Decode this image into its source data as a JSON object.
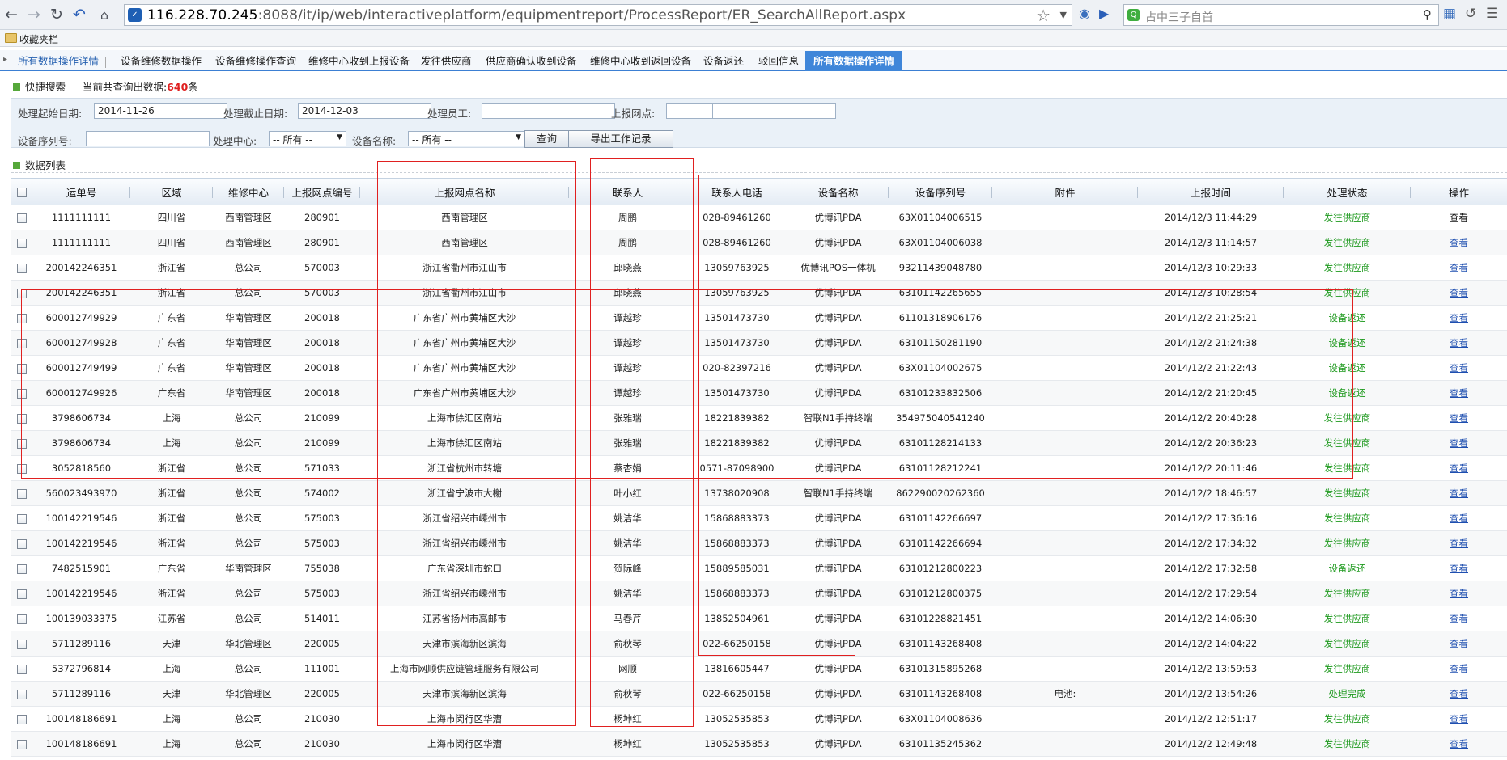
{
  "browser": {
    "url_host": "116.228.70.245",
    "url_path": ":8088/it/ip/web/interactiveplatform/equipmentreport/ProcessReport/ER_SearchAllReport.aspx",
    "search_placeholder": "占中三子自首",
    "bookmarks_label": "收藏夹栏"
  },
  "tabs": {
    "first": "所有数据操作详情",
    "items": [
      "设备维修数据操作",
      "设备维修操作查询",
      "维修中心收到上报设备",
      "发往供应商",
      "供应商确认收到设备",
      "维修中心收到返回设备",
      "设备返还",
      "驳回信息"
    ],
    "active": "所有数据操作详情"
  },
  "search": {
    "heading": "快捷搜索",
    "count_label": "当前共查询出数据:",
    "count_value": "640",
    "count_unit": "条",
    "start_date_label": "处理起始日期:",
    "start_date_value": "2014-11-26",
    "end_date_label": "处理截止日期:",
    "end_date_value": "2014-12-03",
    "staff_label": "处理员工:",
    "staff_value": "",
    "site_label": "上报网点:",
    "serial_label": "设备序列号:",
    "serial_value": "",
    "center_label": "处理中心:",
    "center_value": "-- 所有 --",
    "device_label": "设备名称:",
    "device_value": "-- 所有 --",
    "query_button": "查询",
    "export_button": "导出工作记录"
  },
  "list": {
    "heading": "数据列表",
    "columns": [
      "运单号",
      "区域",
      "维修中心",
      "上报网点编号",
      "上报网点名称",
      "联系人",
      "联系人电话",
      "设备名称",
      "设备序列号",
      "附件",
      "上报时间",
      "处理状态",
      "操作"
    ],
    "rows": [
      [
        "1111111111",
        "四川省",
        "西南管理区",
        "280901",
        "西南管理区",
        "周鹏",
        "028-89461260",
        "优博讯PDA",
        "63X01104006515",
        "",
        "2014/12/3 11:44:29",
        "发往供应商",
        "查看"
      ],
      [
        "1111111111",
        "四川省",
        "西南管理区",
        "280901",
        "西南管理区",
        "周鹏",
        "028-89461260",
        "优博讯PDA",
        "63X01104006038",
        "",
        "2014/12/3 11:14:57",
        "发往供应商",
        "查看"
      ],
      [
        "200142246351",
        "浙江省",
        "总公司",
        "570003",
        "浙江省衢州市江山市",
        "邱晓燕",
        "13059763925",
        "优博讯POS一体机",
        "93211439048780",
        "",
        "2014/12/3 10:29:33",
        "发往供应商",
        "查看"
      ],
      [
        "200142246351",
        "浙江省",
        "总公司",
        "570003",
        "浙江省衢州市江山市",
        "邱晓燕",
        "13059763925",
        "优博讯PDA",
        "63101142265655",
        "",
        "2014/12/3 10:28:54",
        "发往供应商",
        "查看"
      ],
      [
        "600012749929",
        "广东省",
        "华南管理区",
        "200018",
        "广东省广州市黄埔区大沙",
        "谭越珍",
        "13501473730",
        "优博讯PDA",
        "61101318906176",
        "",
        "2014/12/2 21:25:21",
        "设备返还",
        "查看"
      ],
      [
        "600012749928",
        "广东省",
        "华南管理区",
        "200018",
        "广东省广州市黄埔区大沙",
        "谭越珍",
        "13501473730",
        "优博讯PDA",
        "63101150281190",
        "",
        "2014/12/2 21:24:38",
        "设备返还",
        "查看"
      ],
      [
        "600012749499",
        "广东省",
        "华南管理区",
        "200018",
        "广东省广州市黄埔区大沙",
        "谭越珍",
        "020-82397216",
        "优博讯PDA",
        "63X01104002675",
        "",
        "2014/12/2 21:22:43",
        "设备返还",
        "查看"
      ],
      [
        "600012749926",
        "广东省",
        "华南管理区",
        "200018",
        "广东省广州市黄埔区大沙",
        "谭越珍",
        "13501473730",
        "优博讯PDA",
        "63101233832506",
        "",
        "2014/12/2 21:20:45",
        "设备返还",
        "查看"
      ],
      [
        "3798606734",
        "上海",
        "总公司",
        "210099",
        "上海市徐汇区南站",
        "张雅瑞",
        "18221839382",
        "智联N1手持终端",
        "354975040541240",
        "",
        "2014/12/2 20:40:28",
        "发往供应商",
        "查看"
      ],
      [
        "3798606734",
        "上海",
        "总公司",
        "210099",
        "上海市徐汇区南站",
        "张雅瑞",
        "18221839382",
        "优博讯PDA",
        "63101128214133",
        "",
        "2014/12/2 20:36:23",
        "发往供应商",
        "查看"
      ],
      [
        "3052818560",
        "浙江省",
        "总公司",
        "571033",
        "浙江省杭州市转塘",
        "蔡杏娟",
        "0571-87098900",
        "优博讯PDA",
        "63101128212241",
        "",
        "2014/12/2 20:11:46",
        "发往供应商",
        "查看"
      ],
      [
        "560023493970",
        "浙江省",
        "总公司",
        "574002",
        "浙江省宁波市大榭",
        "叶小红",
        "13738020908",
        "智联N1手持终端",
        "862290020262360",
        "",
        "2014/12/2 18:46:57",
        "发往供应商",
        "查看"
      ],
      [
        "100142219546",
        "浙江省",
        "总公司",
        "575003",
        "浙江省绍兴市嵊州市",
        "姚洁华",
        "15868883373",
        "优博讯PDA",
        "63101142266697",
        "",
        "2014/12/2 17:36:16",
        "发往供应商",
        "查看"
      ],
      [
        "100142219546",
        "浙江省",
        "总公司",
        "575003",
        "浙江省绍兴市嵊州市",
        "姚洁华",
        "15868883373",
        "优博讯PDA",
        "63101142266694",
        "",
        "2014/12/2 17:34:32",
        "发往供应商",
        "查看"
      ],
      [
        "7482515901",
        "广东省",
        "华南管理区",
        "755038",
        "广东省深圳市蛇口",
        "贺际峰",
        "15889585031",
        "优博讯PDA",
        "63101212800223",
        "",
        "2014/12/2 17:32:58",
        "设备返还",
        "查看"
      ],
      [
        "100142219546",
        "浙江省",
        "总公司",
        "575003",
        "浙江省绍兴市嵊州市",
        "姚洁华",
        "15868883373",
        "优博讯PDA",
        "63101212800375",
        "",
        "2014/12/2 17:29:54",
        "发往供应商",
        "查看"
      ],
      [
        "100139033375",
        "江苏省",
        "总公司",
        "514011",
        "江苏省扬州市高邮市",
        "马春芹",
        "13852504961",
        "优博讯PDA",
        "63101228821451",
        "",
        "2014/12/2 14:06:30",
        "发往供应商",
        "查看"
      ],
      [
        "5711289116",
        "天津",
        "华北管理区",
        "220005",
        "天津市滨海新区滨海",
        "俞秋琴",
        "022-66250158",
        "优博讯PDA",
        "63101143268408",
        "",
        "2014/12/2 14:04:22",
        "发往供应商",
        "查看"
      ],
      [
        "5372796814",
        "上海",
        "总公司",
        "111001",
        "上海市网顺供应链管理服务有限公司",
        "网顺",
        "13816605447",
        "优博讯PDA",
        "63101315895268",
        "",
        "2014/12/2 13:59:53",
        "发往供应商",
        "查看"
      ],
      [
        "5711289116",
        "天津",
        "华北管理区",
        "220005",
        "天津市滨海新区滨海",
        "俞秋琴",
        "022-66250158",
        "优博讯PDA",
        "63101143268408",
        "电池:",
        "2014/12/2 13:54:26",
        "处理完成",
        "查看"
      ],
      [
        "100148186691",
        "上海",
        "总公司",
        "210030",
        "上海市闵行区华漕",
        "杨坤红",
        "13052535853",
        "优博讯PDA",
        "63X01104008636",
        "",
        "2014/12/2 12:51:17",
        "发往供应商",
        "查看"
      ],
      [
        "100148186691",
        "上海",
        "总公司",
        "210030",
        "上海市闵行区华漕",
        "杨坤红",
        "13052535853",
        "优博讯PDA",
        "63101135245362",
        "",
        "2014/12/2 12:49:48",
        "发往供应商",
        "查看"
      ]
    ]
  },
  "colors": {
    "accent": "#3f86d9",
    "status_green": "#1f9a1f",
    "count_red": "#e02020",
    "annotation_red": "#e02020"
  }
}
